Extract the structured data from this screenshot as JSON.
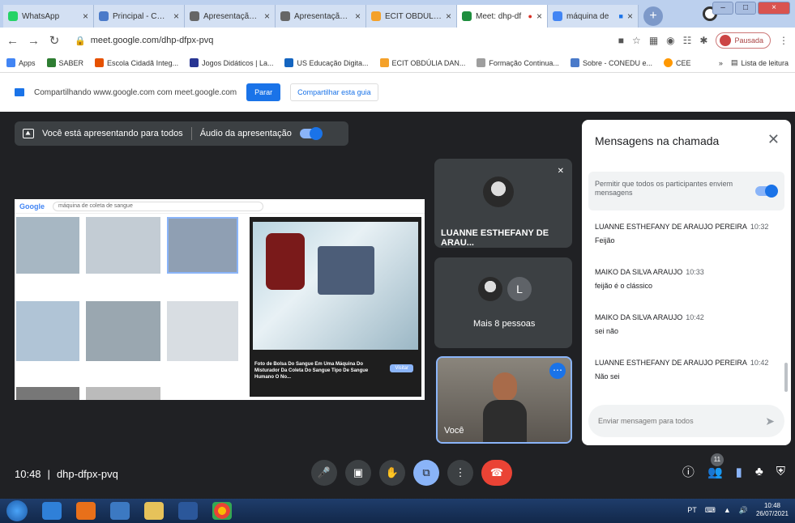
{
  "browser": {
    "tabs": [
      {
        "title": "WhatsApp",
        "color": "#25d366",
        "active": false
      },
      {
        "title": "Principal - CONED",
        "color": "#4a7ac9",
        "active": false
      },
      {
        "title": "Apresentação do",
        "color": "#666666",
        "active": false
      },
      {
        "title": "Apresentação do",
        "color": "#666666",
        "active": false
      },
      {
        "title": "ECIT OBDÚLIA D/",
        "color": "#f4a12a",
        "active": false
      },
      {
        "title": "Meet: dhp-df",
        "color": "#1e8e3e",
        "active": true
      },
      {
        "title": "máquina de",
        "color": "#4285f4",
        "active": false
      }
    ],
    "url": "meet.google.com/dhp-dfpx-pvq",
    "profile_label": "Pausada",
    "bookmarks": [
      "Apps",
      "SABER",
      "Escola Cidadã Integ...",
      "Jogos Didáticos | La...",
      "US Educação Digita...",
      "ECIT OBDÚLIA DAN...",
      "Formação Continua...",
      "Sobre - CONEDU e...",
      "CEE"
    ],
    "reading_list": "Lista de leitura"
  },
  "sharing": {
    "text": "Compartilhando www.google.com com meet.google.com",
    "stop_label": "Parar",
    "share_tab_label": "Compartilhar esta guia"
  },
  "meet": {
    "presenting_text": "Você está apresentando para todos",
    "audio_label": "Áudio da apresentação",
    "presented": {
      "search_text": "máquina de coleta de sangue",
      "viewer_title": "Foto de Bolsa Do Sangue Em Uma Máquina Do Misturador Da Coleta Do Sangue Tipo De Sangue Humano O No...",
      "visit_label": "Visitar"
    },
    "tiles": {
      "participant1": "LUANNE ESTHEFANY DE ARAU...",
      "more_label": "Mais 8 pessoas",
      "more_initial": "L",
      "self_label": "Você"
    },
    "meeting_time": "10:48",
    "meeting_code": "dhp-dfpx-pvq",
    "participants_count": "11"
  },
  "chat": {
    "title": "Mensagens na chamada",
    "allow_text": "Permitir que todos os participantes enviem mensagens",
    "messages": [
      {
        "sender": "LUANNE ESTHEFANY DE ARAUJO PEREIRA",
        "time": "10:32",
        "text": "Feijão"
      },
      {
        "sender": "MAIKO DA SILVA ARAUJO",
        "time": "10:33",
        "text": "feijão é o clássico"
      },
      {
        "sender": "MAIKO DA SILVA ARAUJO",
        "time": "10:42",
        "text": "sei não"
      },
      {
        "sender": "LUANNE ESTHEFANY DE ARAUJO PEREIRA",
        "time": "10:42",
        "text": "Não sei"
      }
    ],
    "input_placeholder": "Enviar mensagem para todos"
  },
  "taskbar": {
    "lang": "PT",
    "time": "10:48",
    "date": "26/07/2021"
  }
}
